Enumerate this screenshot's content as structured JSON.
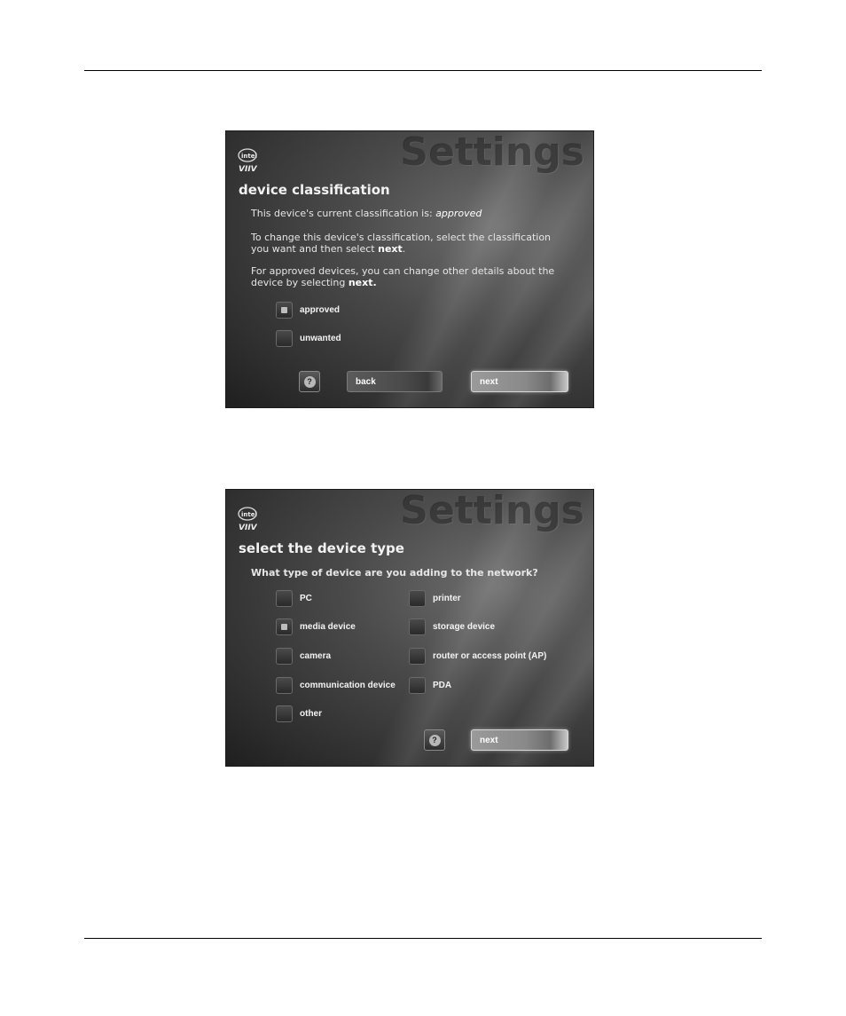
{
  "screen1": {
    "watermark": "Settings",
    "heading": "device classification",
    "line1_prefix": "This device's current classification is: ",
    "line1_value": "approved",
    "para2_line1": "To change this device's classification, select the classification",
    "para2_line2_prefix": "you want and then select ",
    "para2_line2_bold": "next",
    "para2_line2_suffix": ".",
    "para3_line1": "For approved devices, you can change other details about the",
    "para3_line2_prefix": "device by selecting ",
    "para3_line2_bold": "next.",
    "options": [
      {
        "label": "approved",
        "checked": true
      },
      {
        "label": "unwanted",
        "checked": false
      }
    ],
    "help_label": "?",
    "back_label": "back",
    "next_label": "next"
  },
  "screen2": {
    "watermark": "Settings",
    "heading": "select the device type",
    "question": "What type of device are you adding to the network?",
    "options_left": [
      {
        "label": "PC",
        "checked": false
      },
      {
        "label": "media device",
        "checked": true
      },
      {
        "label": "camera",
        "checked": false
      },
      {
        "label": "communication device",
        "checked": false
      },
      {
        "label": "other",
        "checked": false
      }
    ],
    "options_right": [
      {
        "label": "printer",
        "checked": false
      },
      {
        "label": "storage device",
        "checked": false
      },
      {
        "label": "router or access point (AP)",
        "checked": false
      },
      {
        "label": "PDA",
        "checked": false
      }
    ],
    "help_label": "?",
    "next_label": "next"
  },
  "logo": {
    "icon": "intel-viiv-logo",
    "top_text": "intel",
    "bottom_text": "VIIV"
  }
}
